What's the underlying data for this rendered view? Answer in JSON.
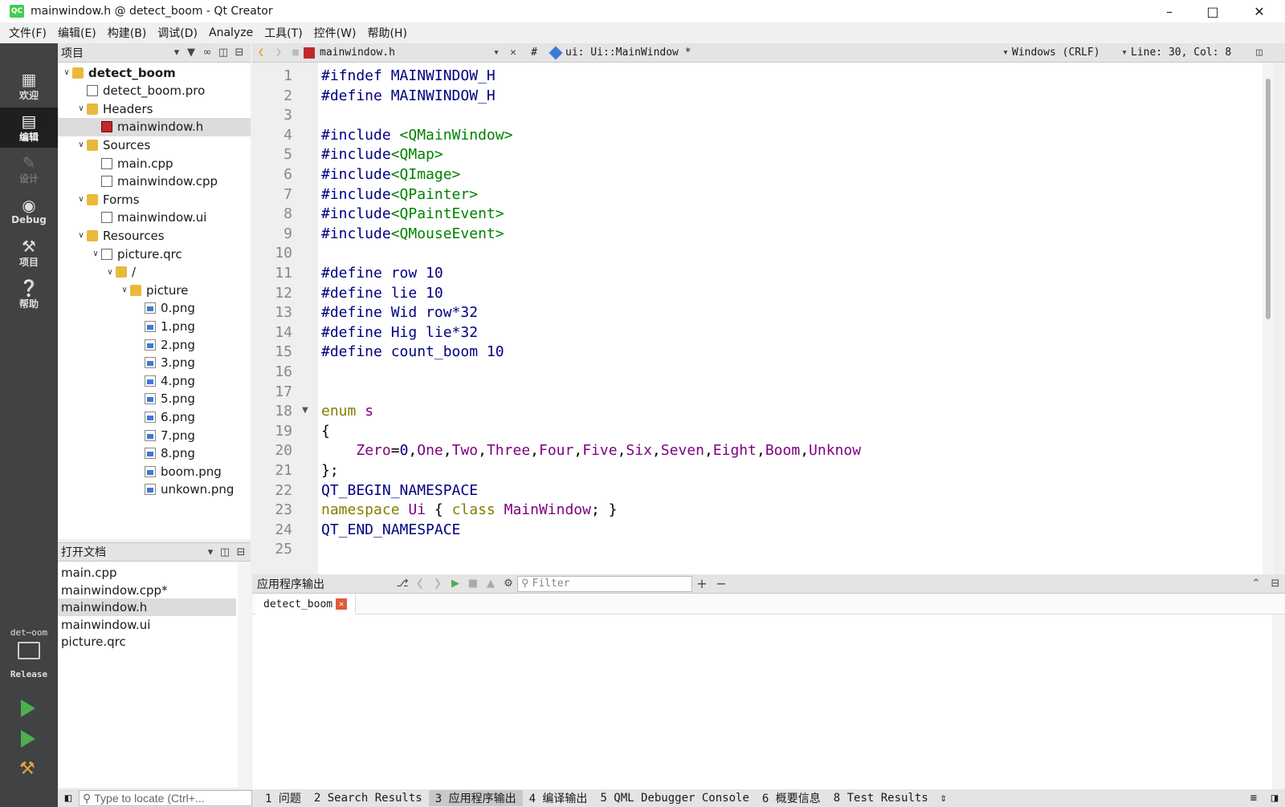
{
  "window": {
    "title": "mainwindow.h @ detect_boom - Qt Creator",
    "logo": "QC"
  },
  "menu": [
    "文件(F)",
    "编辑(E)",
    "构建(B)",
    "调试(D)",
    "Analyze",
    "工具(T)",
    "控件(W)",
    "帮助(H)"
  ],
  "modes": [
    {
      "label": "欢迎",
      "icon": "grid-icon"
    },
    {
      "label": "编辑",
      "icon": "edit-doc-icon"
    },
    {
      "label": "设计",
      "icon": "pencil-icon"
    },
    {
      "label": "Debug",
      "icon": "bug-icon"
    },
    {
      "label": "项目",
      "icon": "wrench-icon"
    },
    {
      "label": "帮助",
      "icon": "help-icon"
    }
  ],
  "kit": {
    "name": "det⋯oom",
    "config": "Release"
  },
  "project_panel": {
    "title": "项目"
  },
  "tree": [
    {
      "label": "detect_boom",
      "depth": 0,
      "arrow": "v",
      "icon": "folder",
      "bold": true
    },
    {
      "label": "detect_boom.pro",
      "depth": 1,
      "arrow": "",
      "icon": "doc"
    },
    {
      "label": "Headers",
      "depth": 1,
      "arrow": "v",
      "icon": "folder"
    },
    {
      "label": "mainwindow.h",
      "depth": 2,
      "arrow": "",
      "icon": "hdr",
      "selected": true
    },
    {
      "label": "Sources",
      "depth": 1,
      "arrow": "v",
      "icon": "folder"
    },
    {
      "label": "main.cpp",
      "depth": 2,
      "arrow": "",
      "icon": "doc"
    },
    {
      "label": "mainwindow.cpp",
      "depth": 2,
      "arrow": "",
      "icon": "doc"
    },
    {
      "label": "Forms",
      "depth": 1,
      "arrow": "v",
      "icon": "folder"
    },
    {
      "label": "mainwindow.ui",
      "depth": 2,
      "arrow": "",
      "icon": "doc"
    },
    {
      "label": "Resources",
      "depth": 1,
      "arrow": "v",
      "icon": "folder"
    },
    {
      "label": "picture.qrc",
      "depth": 2,
      "arrow": "v",
      "icon": "doc"
    },
    {
      "label": "/",
      "depth": 3,
      "arrow": "v",
      "icon": "folder"
    },
    {
      "label": "picture",
      "depth": 4,
      "arrow": "v",
      "icon": "folder"
    },
    {
      "label": "0.png",
      "depth": 5,
      "arrow": "",
      "icon": "png"
    },
    {
      "label": "1.png",
      "depth": 5,
      "arrow": "",
      "icon": "png"
    },
    {
      "label": "2.png",
      "depth": 5,
      "arrow": "",
      "icon": "png"
    },
    {
      "label": "3.png",
      "depth": 5,
      "arrow": "",
      "icon": "png"
    },
    {
      "label": "4.png",
      "depth": 5,
      "arrow": "",
      "icon": "png"
    },
    {
      "label": "5.png",
      "depth": 5,
      "arrow": "",
      "icon": "png"
    },
    {
      "label": "6.png",
      "depth": 5,
      "arrow": "",
      "icon": "png"
    },
    {
      "label": "7.png",
      "depth": 5,
      "arrow": "",
      "icon": "png"
    },
    {
      "label": "8.png",
      "depth": 5,
      "arrow": "",
      "icon": "png"
    },
    {
      "label": "boom.png",
      "depth": 5,
      "arrow": "",
      "icon": "png"
    },
    {
      "label": "unkown.png",
      "depth": 5,
      "arrow": "",
      "icon": "png"
    }
  ],
  "open_docs": {
    "title": "打开文档",
    "items": [
      {
        "label": "main.cpp"
      },
      {
        "label": "mainwindow.cpp*"
      },
      {
        "label": "mainwindow.h",
        "selected": true
      },
      {
        "label": "mainwindow.ui"
      },
      {
        "label": "picture.qrc"
      }
    ]
  },
  "editor_toolbar": {
    "file": "mainwindow.h",
    "hash": "#",
    "symbol": "ui: Ui::MainWindow *",
    "line_ending": "Windows (CRLF)",
    "position": "Line: 30, Col: 8"
  },
  "code_lines": [
    [
      [
        "pp",
        "#ifndef MAINWINDOW_H"
      ]
    ],
    [
      [
        "pp",
        "#define MAINWINDOW_H"
      ]
    ],
    [],
    [
      [
        "pp",
        "#include "
      ],
      [
        "inc",
        "<QMainWindow>"
      ]
    ],
    [
      [
        "pp",
        "#include"
      ],
      [
        "inc",
        "<QMap>"
      ]
    ],
    [
      [
        "pp",
        "#include"
      ],
      [
        "inc",
        "<QImage>"
      ]
    ],
    [
      [
        "pp",
        "#include"
      ],
      [
        "inc",
        "<QPainter>"
      ]
    ],
    [
      [
        "pp",
        "#include"
      ],
      [
        "inc",
        "<QPaintEvent>"
      ]
    ],
    [
      [
        "pp",
        "#include"
      ],
      [
        "inc",
        "<QMouseEvent>"
      ]
    ],
    [],
    [
      [
        "pp",
        "#define row 10"
      ]
    ],
    [
      [
        "pp",
        "#define lie 10"
      ]
    ],
    [
      [
        "pp",
        "#define Wid row*32"
      ]
    ],
    [
      [
        "pp",
        "#define Hig lie*32"
      ]
    ],
    [
      [
        "pp",
        "#define count_boom 10"
      ]
    ],
    [],
    [],
    [
      [
        "kw",
        "enum "
      ],
      [
        "en",
        "s"
      ]
    ],
    [
      [
        "txt",
        "{"
      ]
    ],
    [
      [
        "txt",
        "    "
      ],
      [
        "en",
        "Zero"
      ],
      [
        "txt",
        "="
      ],
      [
        "num",
        "0"
      ],
      [
        "txt",
        ","
      ],
      [
        "en",
        "One"
      ],
      [
        "txt",
        ","
      ],
      [
        "en",
        "Two"
      ],
      [
        "txt",
        ","
      ],
      [
        "en",
        "Three"
      ],
      [
        "txt",
        ","
      ],
      [
        "en",
        "Four"
      ],
      [
        "txt",
        ","
      ],
      [
        "en",
        "Five"
      ],
      [
        "txt",
        ","
      ],
      [
        "en",
        "Six"
      ],
      [
        "txt",
        ","
      ],
      [
        "en",
        "Seven"
      ],
      [
        "txt",
        ","
      ],
      [
        "en",
        "Eight"
      ],
      [
        "txt",
        ","
      ],
      [
        "en",
        "Boom"
      ],
      [
        "txt",
        ","
      ],
      [
        "en",
        "Unknow"
      ]
    ],
    [
      [
        "txt",
        "};"
      ]
    ],
    [
      [
        "pp",
        "QT_BEGIN_NAMESPACE"
      ]
    ],
    [
      [
        "kw",
        "namespace "
      ],
      [
        "en",
        "Ui"
      ],
      [
        "txt",
        " { "
      ],
      [
        "kw",
        "class "
      ],
      [
        "en",
        "MainWindow"
      ],
      [
        "txt",
        "; }"
      ]
    ],
    [
      [
        "pp",
        "QT_END_NAMESPACE"
      ]
    ],
    []
  ],
  "line_numbers": [
    "1",
    "2",
    "3",
    "4",
    "5",
    "6",
    "7",
    "8",
    "9",
    "10",
    "11",
    "12",
    "13",
    "14",
    "15",
    "16",
    "17",
    "18",
    "19",
    "20",
    "21",
    "22",
    "23",
    "24",
    "25"
  ],
  "output_pane": {
    "title": "应用程序输出",
    "filter_placeholder": "Filter",
    "tab": "detect_boom"
  },
  "locator": {
    "placeholder": "Type to locate (Ctrl+..."
  },
  "status_tabs": [
    "1 问题",
    "2 Search Results",
    "3 应用程序输出",
    "4 编译输出",
    "5 QML Debugger Console",
    "6 概要信息",
    "8 Test Results"
  ],
  "status_active": 2
}
